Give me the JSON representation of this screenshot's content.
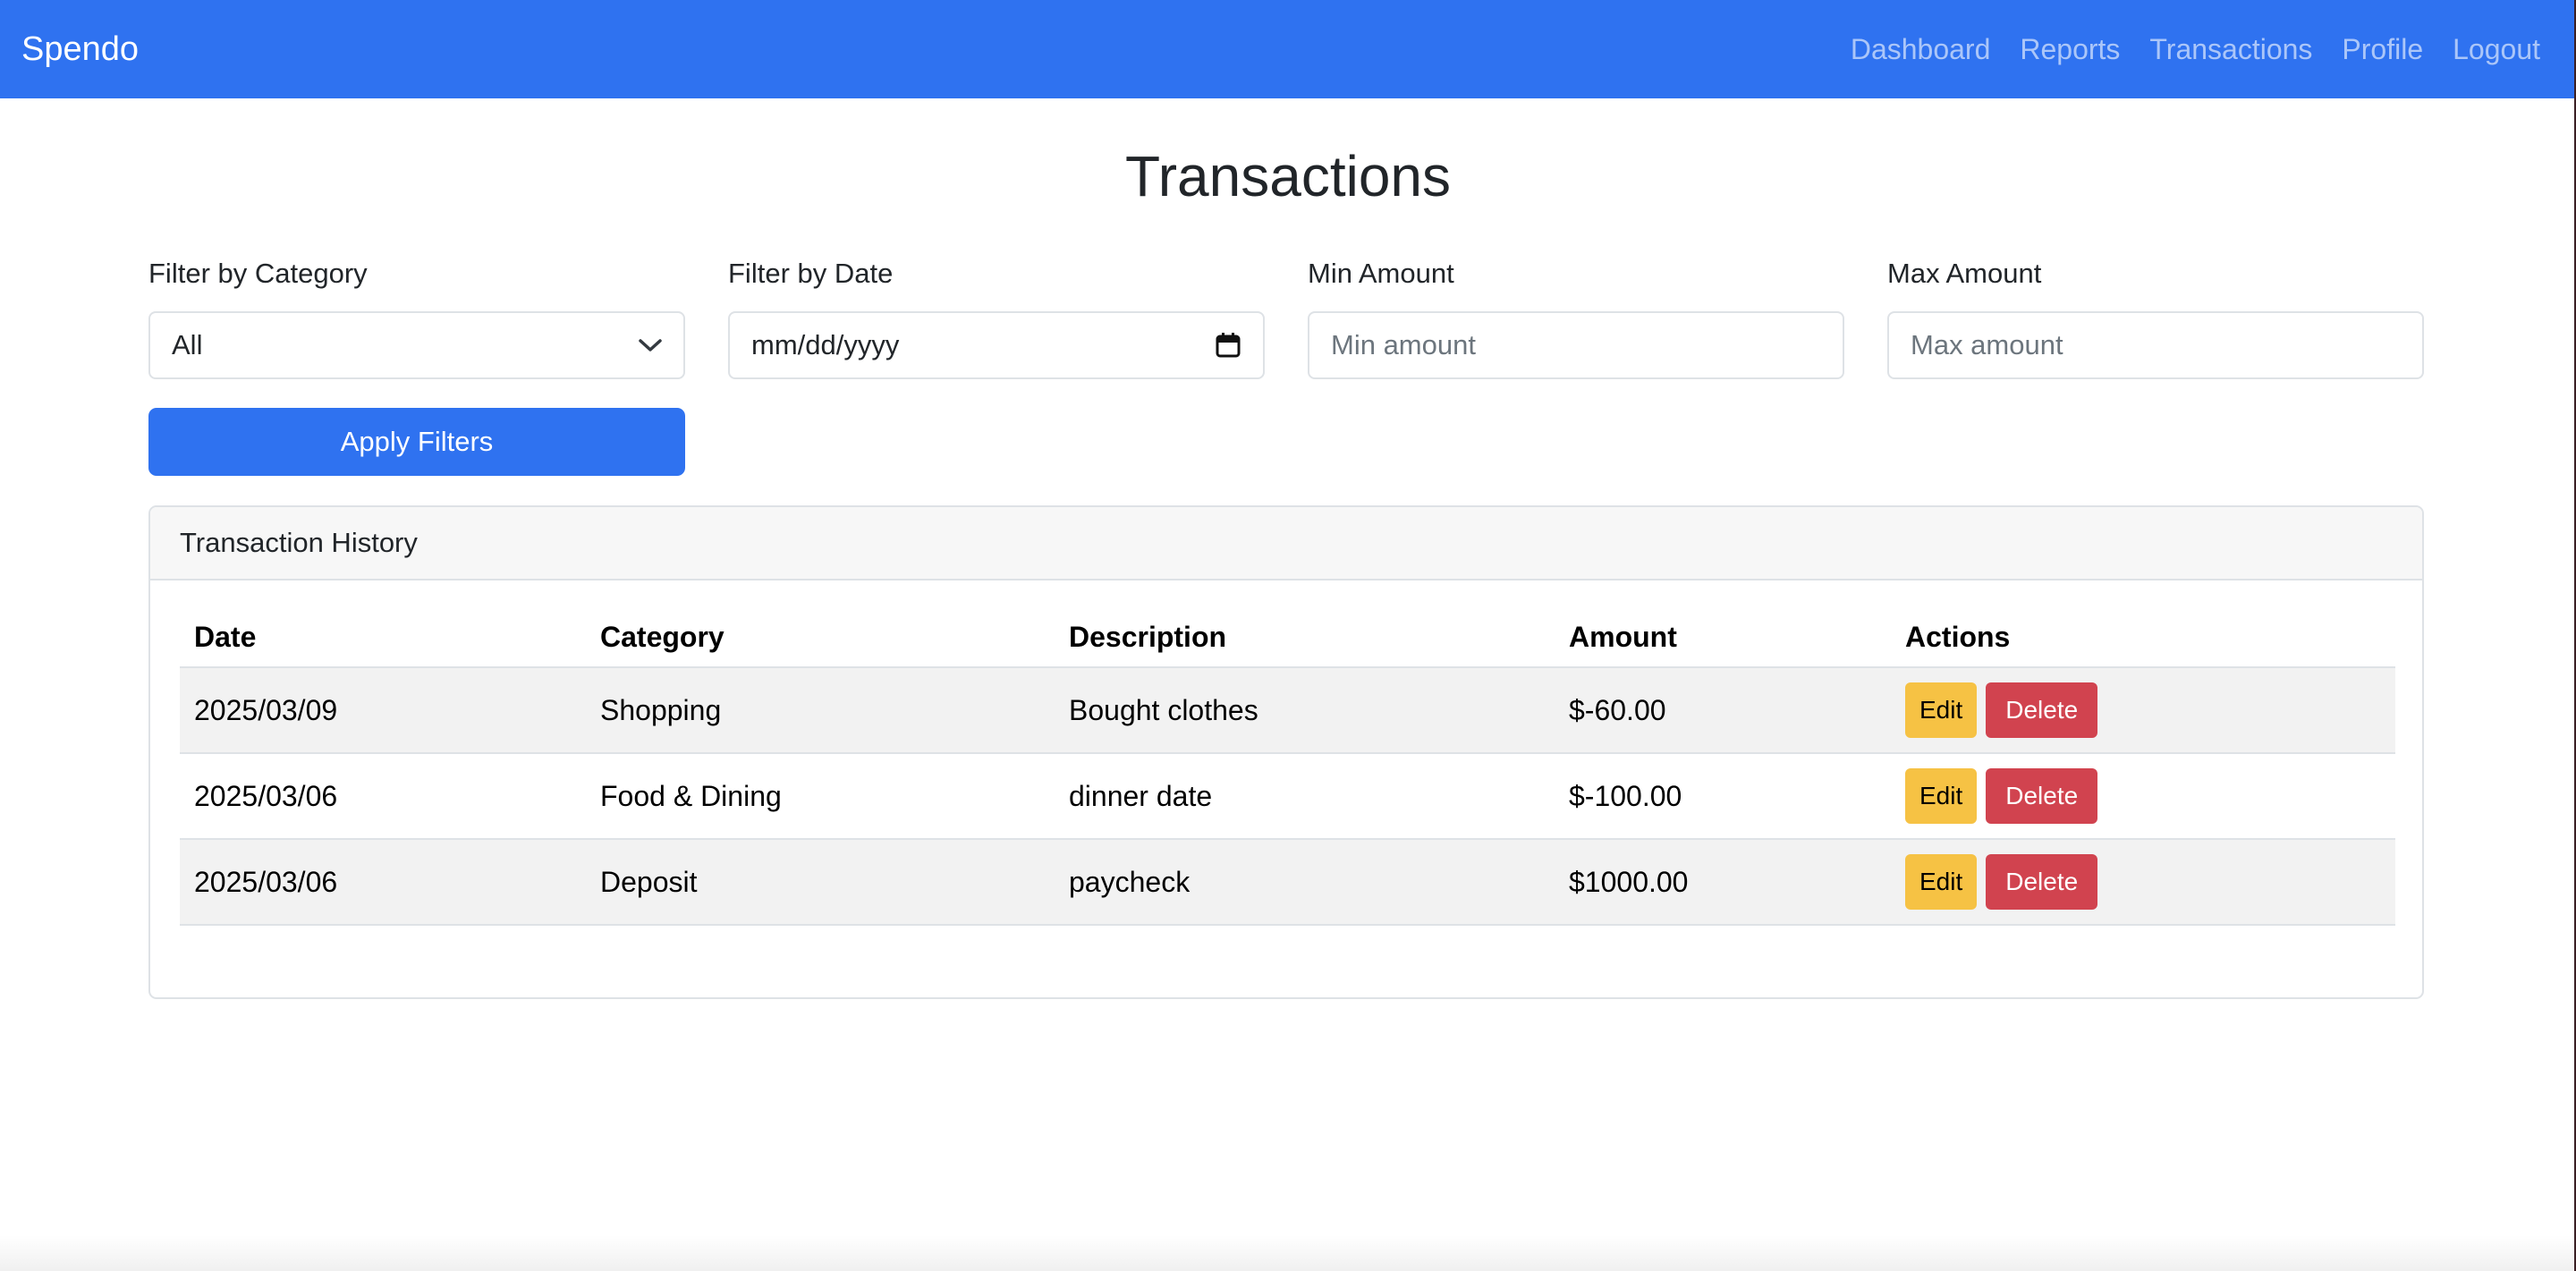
{
  "nav": {
    "brand": "Spendo",
    "links": [
      "Dashboard",
      "Reports",
      "Transactions",
      "Profile",
      "Logout"
    ]
  },
  "page": {
    "title": "Transactions"
  },
  "filters": {
    "category": {
      "label": "Filter by Category",
      "value": "All"
    },
    "date": {
      "label": "Filter by Date",
      "placeholder": "mm/dd/yyyy"
    },
    "min": {
      "label": "Min Amount",
      "placeholder": "Min amount"
    },
    "max": {
      "label": "Max Amount",
      "placeholder": "Max amount"
    },
    "apply_label": "Apply Filters"
  },
  "history": {
    "title": "Transaction History",
    "columns": [
      "Date",
      "Category",
      "Description",
      "Amount",
      "Actions"
    ],
    "rows": [
      {
        "date": "2025/03/09",
        "category": "Shopping",
        "description": "Bought clothes",
        "amount": "$-60.00"
      },
      {
        "date": "2025/03/06",
        "category": "Food & Dining",
        "description": "dinner date",
        "amount": "$-100.00"
      },
      {
        "date": "2025/03/06",
        "category": "Deposit",
        "description": "paycheck",
        "amount": "$1000.00"
      }
    ],
    "edit_label": "Edit",
    "delete_label": "Delete"
  },
  "colors": {
    "primary": "#2f72f0",
    "warning": "#f6c244",
    "danger": "#d1434f"
  },
  "icons": {
    "category_dropdown": "chevron-down-icon",
    "date_picker": "calendar-icon"
  }
}
